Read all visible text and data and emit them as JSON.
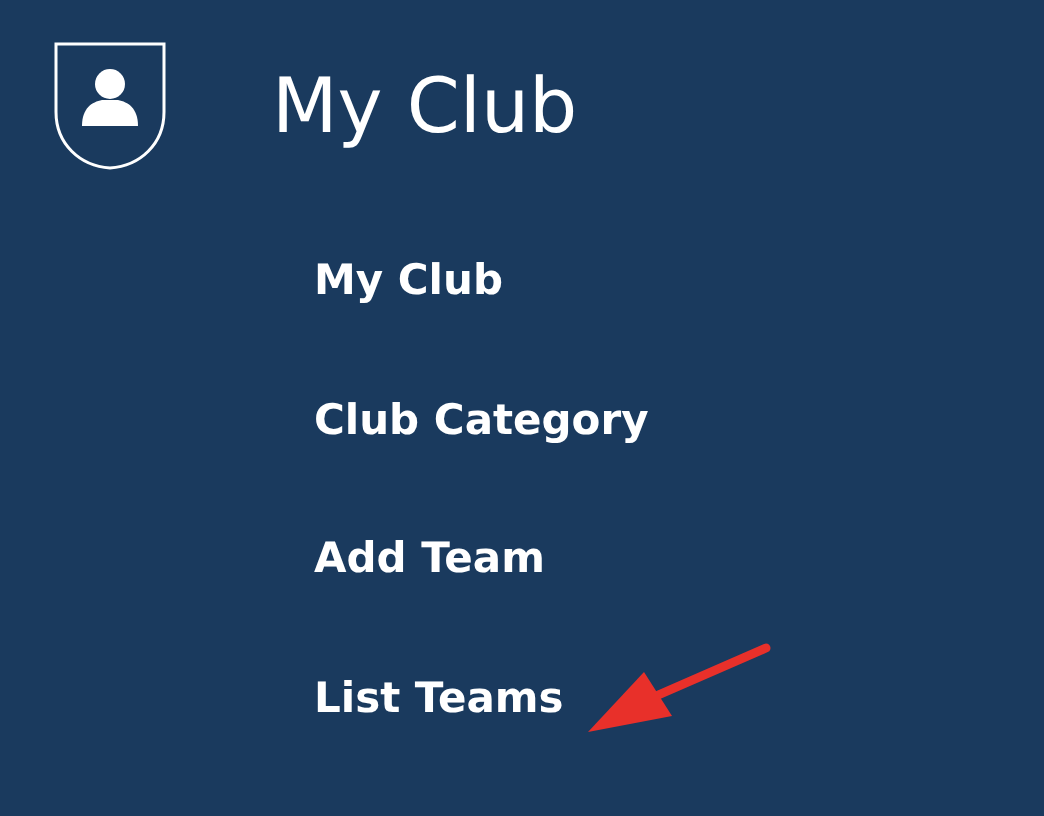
{
  "header": {
    "title": "My Club"
  },
  "menu": [
    {
      "label": "My Club"
    },
    {
      "label": "Club Category"
    },
    {
      "label": "Add Team"
    },
    {
      "label": "List Teams"
    }
  ]
}
